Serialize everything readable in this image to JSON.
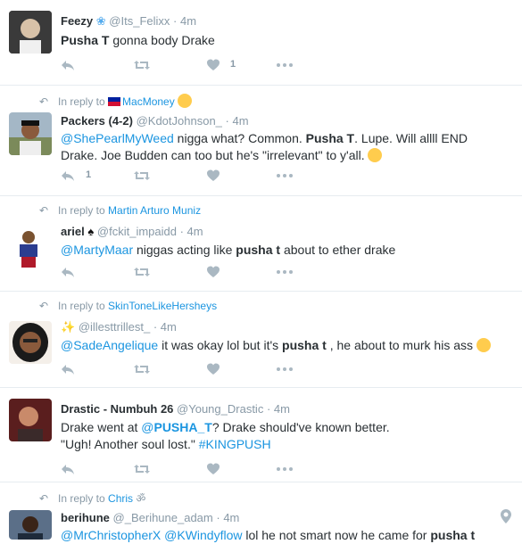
{
  "tweets": [
    {
      "name": "Feezy",
      "handle": "@Its_Felixx",
      "time": "· 4m",
      "text_parts": [
        "Pusha T",
        " gonna body Drake"
      ],
      "like_count": "1"
    },
    {
      "reply_prefix": "In reply to ",
      "reply_to": "MacMoney",
      "name": "Packers (4-2)",
      "handle": "@KdotJohnson_",
      "time": "· 4m",
      "mention": "@ShePearlMyWeed",
      "t1": " nigga what? Common. ",
      "b1": "Pusha T",
      "t2": ". Lupe. Will allll END",
      "line2": "Drake. Joe Budden can too but he's \"irrelevant\" to y'all.",
      "reply_count": "1"
    },
    {
      "reply_prefix": "In reply to ",
      "reply_to": "Martin Arturo Muniz",
      "name": "ariel",
      "handle": "@fckit_impaidd",
      "time": "· 4m",
      "mention": "@MartyMaar",
      "t1": " niggas acting like ",
      "b1": "pusha t",
      "t2": " about to ether drake"
    },
    {
      "reply_prefix": "In reply to ",
      "reply_to": "SkinToneLikeHersheys",
      "handle": "@illesttrillest_",
      "time": "· 4m",
      "mention": "@SadeAngelique",
      "t1": " it was okay lol but it's ",
      "b1": "pusha t",
      "t2": " , he about to murk his ass"
    },
    {
      "name": "Drastic - Numbuh 26",
      "handle": "@Young_Drastic",
      "time": "· 4m",
      "t0": "Drake went at ",
      "mention_prefix": "@",
      "mention_bold": "PUSHA_T",
      "t1": "? Drake should've known better.",
      "line2a": "\"Ugh! Another soul lost.\" ",
      "hashtag": "#KINGPUSH"
    },
    {
      "reply_prefix": "In reply to ",
      "reply_to": "Chris",
      "name": "berihune",
      "handle": "@_Berihune_adam",
      "time": "· 4m",
      "mention": "@MrChristopherX",
      "mention2": "@KWindyflow",
      "t1": " lol he not smart now he came for ",
      "b1": "pusha t"
    }
  ],
  "colors": {
    "link": "#1b95e0",
    "muted": "#8899a6",
    "icon": "#aab8c2",
    "text": "#292f33"
  }
}
